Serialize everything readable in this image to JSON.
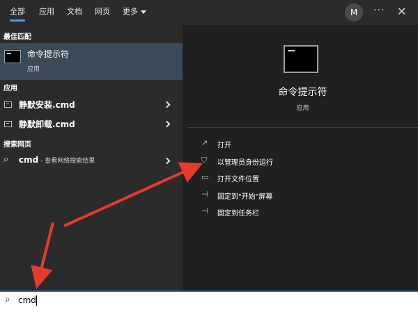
{
  "top_tabs": [
    {
      "label": "全部"
    },
    {
      "label": "应用"
    },
    {
      "label": "文档"
    },
    {
      "label": "网页"
    },
    {
      "label": "更多"
    }
  ],
  "avatar_initial": "M",
  "ellipsis_glyph": "···",
  "close_glyph": "✕",
  "left": {
    "best_match_header": "最佳匹配",
    "best_match": {
      "title": "命令提示符",
      "subtitle": "应用"
    },
    "apps_header": "应用",
    "apps": [
      {
        "label": "静默安装.cmd"
      },
      {
        "label": "静默卸载.cmd"
      }
    ],
    "web_header": "搜索网页",
    "web_result": {
      "query": "cmd",
      "suffix": " - 查看网络搜索结果"
    }
  },
  "right": {
    "app_title": "命令提示符",
    "app_subtitle": "应用",
    "actions": [
      {
        "label": "打开",
        "icon": "open-icon"
      },
      {
        "label": "以管理员身份运行",
        "icon": "shield-admin-icon"
      },
      {
        "label": "打开文件位置",
        "icon": "folder-icon"
      },
      {
        "label": "固定到\"开始\"屏幕",
        "icon": "pin-icon"
      },
      {
        "label": "固定到任务栏",
        "icon": "pin-icon"
      }
    ]
  },
  "search_box": {
    "value": "cmd"
  },
  "colors": {
    "accent": "#4aa0e6",
    "selection": "#3b4a57",
    "arrow": "#e63a2e"
  }
}
